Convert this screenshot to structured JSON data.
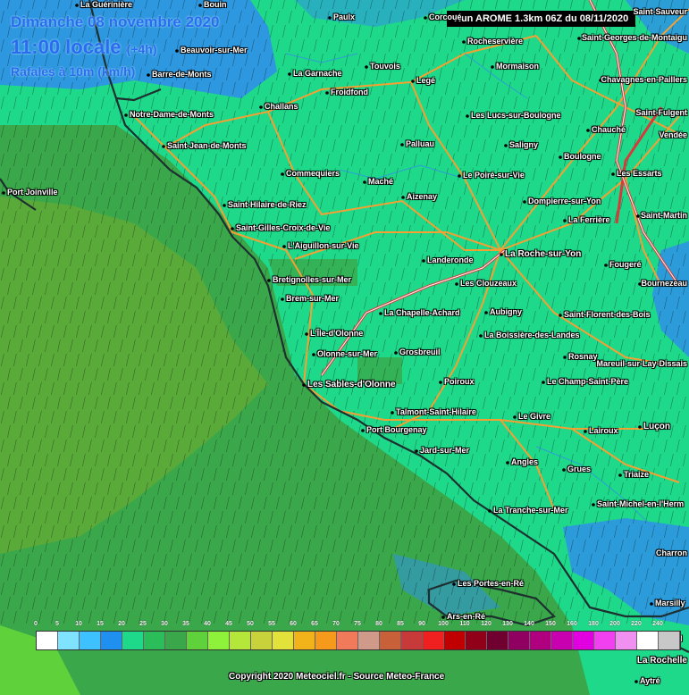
{
  "header": {
    "date": "Dimanche 08 novembre 2020",
    "time": "11:00 locale",
    "offset": "(+4h)",
    "variable": "Rafales à 10m (km/h)"
  },
  "run_label": "Run AROME 1.3km 06Z du 08/11/2020",
  "copyright": "Copyright 2020 Meteociel.fr - Source Meteo-France",
  "colors": {
    "sea_low": "#3a8f4a",
    "sea_mid": "#5aaa3a",
    "land": "#1fd98a",
    "calm": "#2f8fe8",
    "road": "#f5a033",
    "motorway": "#d63a3a",
    "coast": "#1e2f2f",
    "arrow": "#111111"
  },
  "legend": {
    "ticks": [
      "0",
      "5",
      "10",
      "15",
      "20",
      "25",
      "30",
      "35",
      "40",
      "45",
      "50",
      "55",
      "60",
      "65",
      "70",
      "75",
      "80",
      "85",
      "90",
      "100",
      "110",
      "120",
      "130",
      "140",
      "150",
      "160",
      "180",
      "200",
      "220",
      "240"
    ],
    "colors": [
      "#ffffff",
      "#7fe3ff",
      "#3ec1ff",
      "#1f8ff0",
      "#1fd98a",
      "#2bbd5a",
      "#3aa84a",
      "#5fd13a",
      "#8ff23a",
      "#b5e63a",
      "#c8d23a",
      "#e2e23a",
      "#f2b21a",
      "#f59a1a",
      "#f07a5a",
      "#d09a8a",
      "#c8603a",
      "#c83a3a",
      "#f02020",
      "#c00000",
      "#900018",
      "#700030",
      "#900060",
      "#b00080",
      "#c800b0",
      "#e000e0",
      "#f040f0",
      "#f090f0",
      "#ffffff",
      "#c8c8c8"
    ]
  },
  "towns": [
    {
      "name": "La Guérinière"
    },
    {
      "name": "Bouin"
    },
    {
      "name": "Paulx"
    },
    {
      "name": "Corcoué"
    },
    {
      "name": "Beauvoir-sur-Mer"
    },
    {
      "name": "Barre-de-Monts"
    },
    {
      "name": "Touvois"
    },
    {
      "name": "La Garnache"
    },
    {
      "name": "Legé"
    },
    {
      "name": "Froidfond"
    },
    {
      "name": "Challans"
    },
    {
      "name": "Notre-Dame-de-Monts"
    },
    {
      "name": "Saint-Jean-de-Monts"
    },
    {
      "name": "Palluau"
    },
    {
      "name": "Commequiers"
    },
    {
      "name": "Maché"
    },
    {
      "name": "Aizenay"
    },
    {
      "name": "Port Joinville"
    },
    {
      "name": "Saint-Hilaire-de-Riez"
    },
    {
      "name": "Saint-Gilles-Croix-de-Vie"
    },
    {
      "name": "L'Aiguillon-sur-Vie"
    },
    {
      "name": "Bretignolles-sur-Mer"
    },
    {
      "name": "Brem-sur-Mer"
    },
    {
      "name": "L'Île-d'Olonne"
    },
    {
      "name": "Olonne-sur-Mer"
    },
    {
      "name": "Les Sables-d'Olonne"
    },
    {
      "name": "Rocheservière"
    },
    {
      "name": "Mormaison"
    },
    {
      "name": "Les Lucs-sur-Boulogne"
    },
    {
      "name": "Saligny"
    },
    {
      "name": "Le Poiré-sur-Vie"
    },
    {
      "name": "Landeronde"
    },
    {
      "name": "La Roche-sur-Yon"
    },
    {
      "name": "Les Clouzeaux"
    },
    {
      "name": "Aubigny"
    },
    {
      "name": "La Chapelle-Achard"
    },
    {
      "name": "Grosbreuil"
    },
    {
      "name": "Poiroux"
    },
    {
      "name": "La Boissière-des-Landes"
    },
    {
      "name": "Talmont-Saint-Hilaire"
    },
    {
      "name": "Port Bourgenay"
    },
    {
      "name": "Jard-sur-Mer"
    },
    {
      "name": "Le Givre"
    },
    {
      "name": "Angles"
    },
    {
      "name": "Grues"
    },
    {
      "name": "La Tranche-sur-Mer"
    },
    {
      "name": "Saint-Georges-de-Montaigu"
    },
    {
      "name": "Chavagnes-en-Paillers"
    },
    {
      "name": "Saint-Fulgent"
    },
    {
      "name": "Chauché"
    },
    {
      "name": "Boulogne"
    },
    {
      "name": "Les Essarts"
    },
    {
      "name": "Dompierre-sur-Yon"
    },
    {
      "name": "La Ferrière"
    },
    {
      "name": "Saint-Martin"
    },
    {
      "name": "Fougeré"
    },
    {
      "name": "Bournezeau"
    },
    {
      "name": "Saint-Florent-des-Bois"
    },
    {
      "name": "Rosnay"
    },
    {
      "name": "Mareuil-sur-Lay-Dissais"
    },
    {
      "name": "Le Champ-Saint-Père"
    },
    {
      "name": "Luçon"
    },
    {
      "name": "Lairoux"
    },
    {
      "name": "Triaize"
    },
    {
      "name": "Saint-Michel-en-l'Herm"
    },
    {
      "name": "Les Portes-en-Ré"
    },
    {
      "name": "Ars-en-Ré"
    },
    {
      "name": "Marsilly"
    },
    {
      "name": "Vendée"
    },
    {
      "name": "Charron"
    },
    {
      "name": "Saint-Sauveur"
    },
    {
      "name": "Lagord"
    },
    {
      "name": "La Rochelle"
    },
    {
      "name": "Aytré"
    }
  ]
}
